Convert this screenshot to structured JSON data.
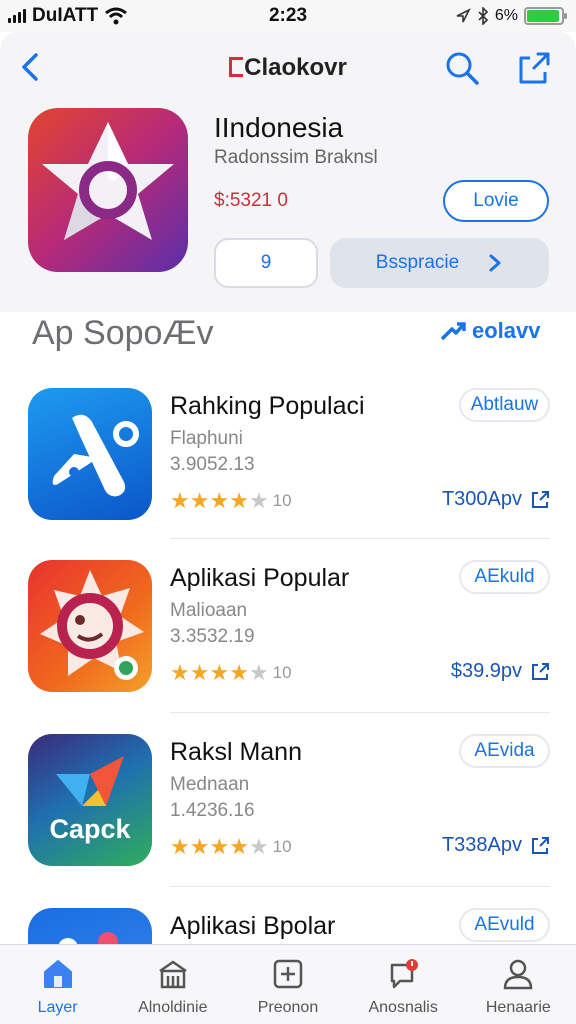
{
  "status_bar": {
    "carrier": "DuIATT",
    "time": "2:23",
    "battery_text": "6%",
    "battery_level": 0.95
  },
  "nav": {
    "title": "Claokovr",
    "back_icon": "chevron-left-icon",
    "search_icon": "search-icon",
    "share_icon": "share-icon"
  },
  "hero": {
    "title": "IIndonesia",
    "subtitle": "Radonssim Braknsl",
    "price": "$:5321 0",
    "love_label": "Lovie",
    "small_button_label": "9",
    "wide_button_label": "Bsspracie"
  },
  "section": {
    "title": "Ap SopoÆv",
    "see_all": "eolavv"
  },
  "apps": [
    {
      "name": "Rahking Populaci",
      "category": "Flaphuni",
      "version": "3.9052.13",
      "rating": 4,
      "rating_count": "10",
      "action": "Abtlauw",
      "price": "T300Apv"
    },
    {
      "name": "Aplikasi Popular",
      "category": "Malioaan",
      "version": "3.3532.19",
      "rating": 4,
      "rating_count": "10",
      "action": "AEkuld",
      "price": "$39.9pv"
    },
    {
      "name": "Raksl Mann",
      "category": "Mednaan",
      "version": "1.4236.16",
      "rating": 4,
      "rating_count": "10",
      "action": "AEvida",
      "price": "T338Apv"
    },
    {
      "name": "Aplikasi Bpolar",
      "action": "AEvuld"
    }
  ],
  "tabs": [
    {
      "label": "Layer",
      "icon": "home-icon",
      "active": true
    },
    {
      "label": "Alnoldinie",
      "icon": "store-icon",
      "active": false
    },
    {
      "label": "Preonon",
      "icon": "plus-square-icon",
      "active": false
    },
    {
      "label": "Anosnalis",
      "icon": "chat-notification-icon",
      "active": false
    },
    {
      "label": "Henaarie",
      "icon": "person-icon",
      "active": false
    }
  ],
  "colors": {
    "accent": "#1a73e8",
    "price_red": "#c8303a",
    "star": "#f5a623"
  }
}
